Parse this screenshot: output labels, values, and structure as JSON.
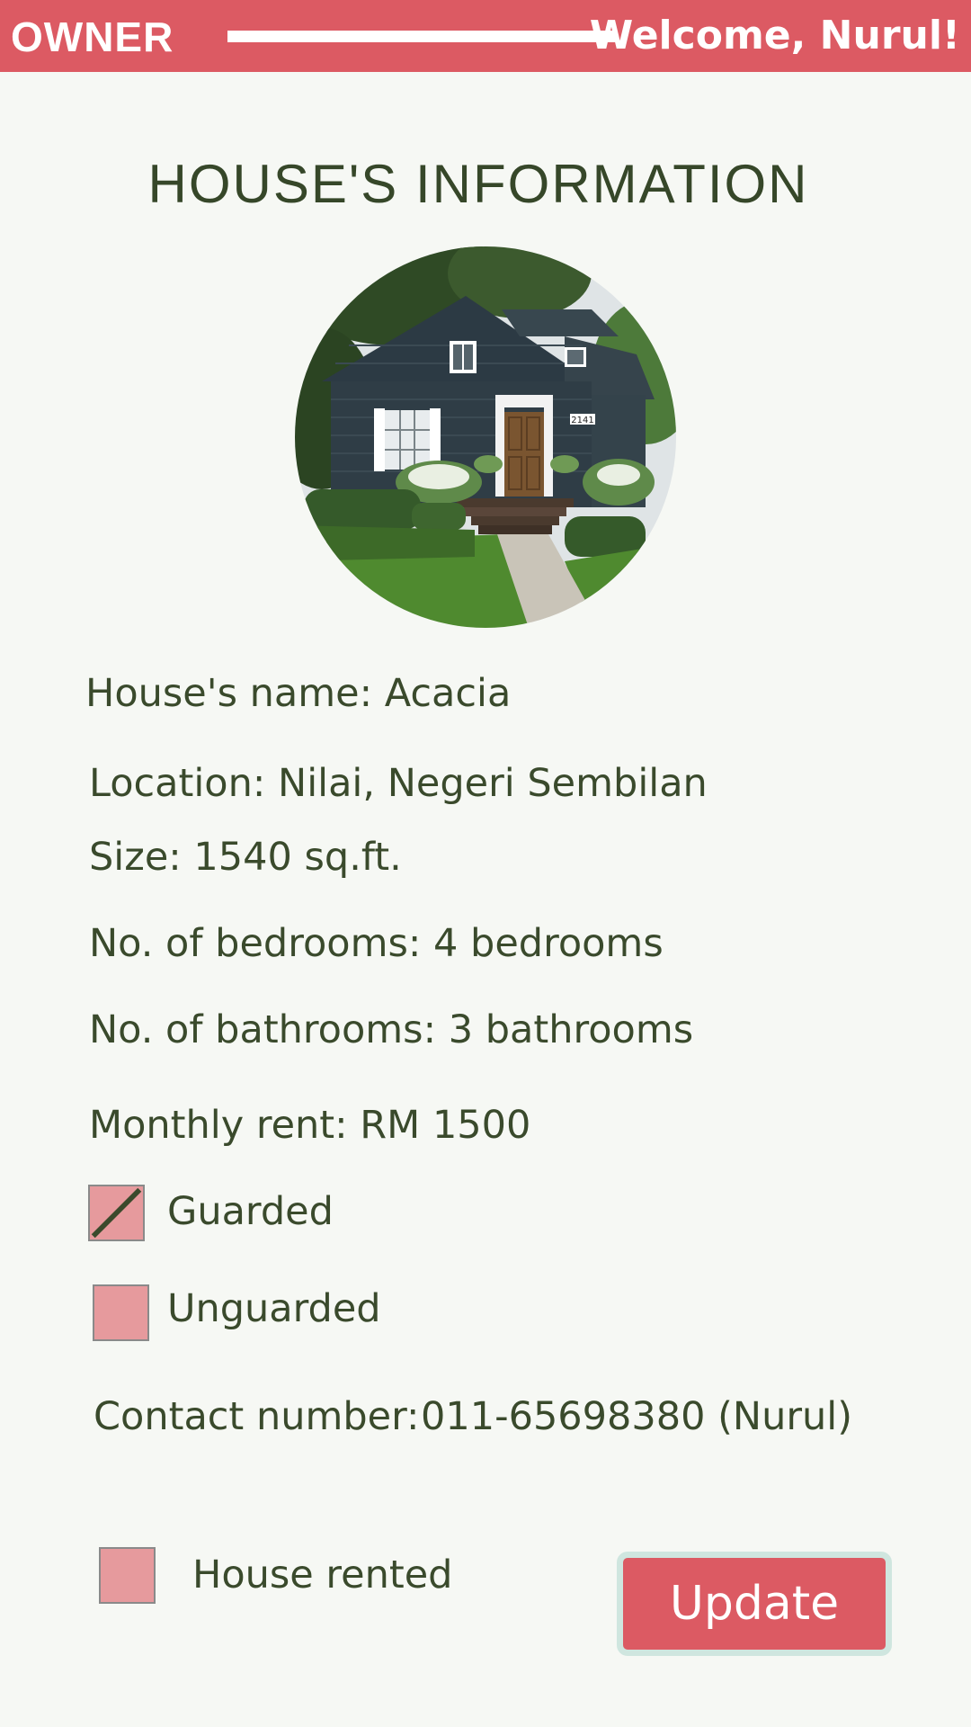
{
  "header": {
    "role": "OWNER",
    "welcome": "Welcome, Nurul!"
  },
  "page": {
    "title": "HOUSE'S INFORMATION"
  },
  "house": {
    "name_line": "House's name: Acacia",
    "location_line": "Location: Nilai, Negeri Sembilan",
    "size_line": "Size: 1540 sq.ft.",
    "bedrooms_line": "No. of bedrooms: 4 bedrooms",
    "bathrooms_line": "No. of bathrooms: 3 bathrooms",
    "rent_line": "Monthly rent: RM 1500",
    "contact_label": "Contact number:",
    "contact_value": "011-65698380 (Nurul)",
    "door_number": "2141"
  },
  "security": {
    "options": [
      {
        "label": "Guarded",
        "checked": true
      },
      {
        "label": "Unguarded",
        "checked": false
      }
    ]
  },
  "rented": {
    "label": "House rented",
    "checked": false
  },
  "actions": {
    "update_label": "Update"
  },
  "colors": {
    "accent": "#dc5a63",
    "background": "#f6f8f4",
    "text": "#3a4a2c",
    "checkbox_fill": "#e69a9d",
    "button_border": "#cfe6df"
  }
}
